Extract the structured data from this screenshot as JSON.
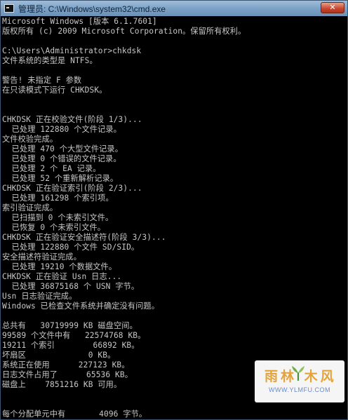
{
  "window": {
    "title": "管理员: C:\\Windows\\system32\\cmd.exe",
    "close_label": "✕"
  },
  "console": {
    "lines": [
      "Microsoft Windows [版本 6.1.7601]",
      "版权所有 (c) 2009 Microsoft Corporation。保留所有权利。",
      "",
      "C:\\Users\\Administrator>chkdsk",
      "文件系统的类型是 NTFS。",
      "",
      "警告! 未指定 F 参数",
      "在只读模式下运行 CHKDSK。",
      "",
      "",
      "CHKDSK 正在校验文件(阶段 1/3)...",
      "  已处理 122880 个文件记录。",
      "文件校验完成。",
      "  已处理 470 个大型文件记录。",
      "  已处理 0 个错误的文件记录。",
      "  已处理 2 个 EA 记录。",
      "  已处理 52 个重新解析记录。",
      "CHKDSK 正在验证索引(阶段 2/3)...",
      "  已处理 161298 个索引项。",
      "索引验证完成。",
      "  已扫描到 0 个未索引文件。",
      "  已恢复 0 个未索引文件。",
      "CHKDSK 正在验证安全描述符(阶段 3/3)...",
      "  已处理 122880 个文件 SD/SID。",
      "安全描述符验证完成。",
      "  已处理 19210 个数据文件。",
      "CHKDSK 正在验证 Usn 日志...",
      "  已处理 36875168 个 USN 字节。",
      "Usn 日志验证完成。",
      "Windows 已检查文件系统并确定没有问题。",
      "",
      "总共有   30719999 KB 磁盘空间。",
      "99589 个文件中有   22574768 KB。",
      "19211 个索引        66892 KB。",
      "坏扇区             0 KB。",
      "系统正在使用      227123 KB。",
      "日志文件占用了      65536 KB。",
      "磁盘上    7851216 KB 可用。",
      "",
      "",
      "每个分配单元中有       4096 字节。"
    ]
  },
  "watermark": {
    "logo_text": "雨林  木风",
    "url": "WWW.YLMFU.COM"
  },
  "colors": {
    "console_bg": "#000000",
    "console_text": "#c7c7c7",
    "titlebar": "#7aa0c5",
    "close_button": "#c8452d",
    "watermark_logo": "#e3a33a"
  }
}
